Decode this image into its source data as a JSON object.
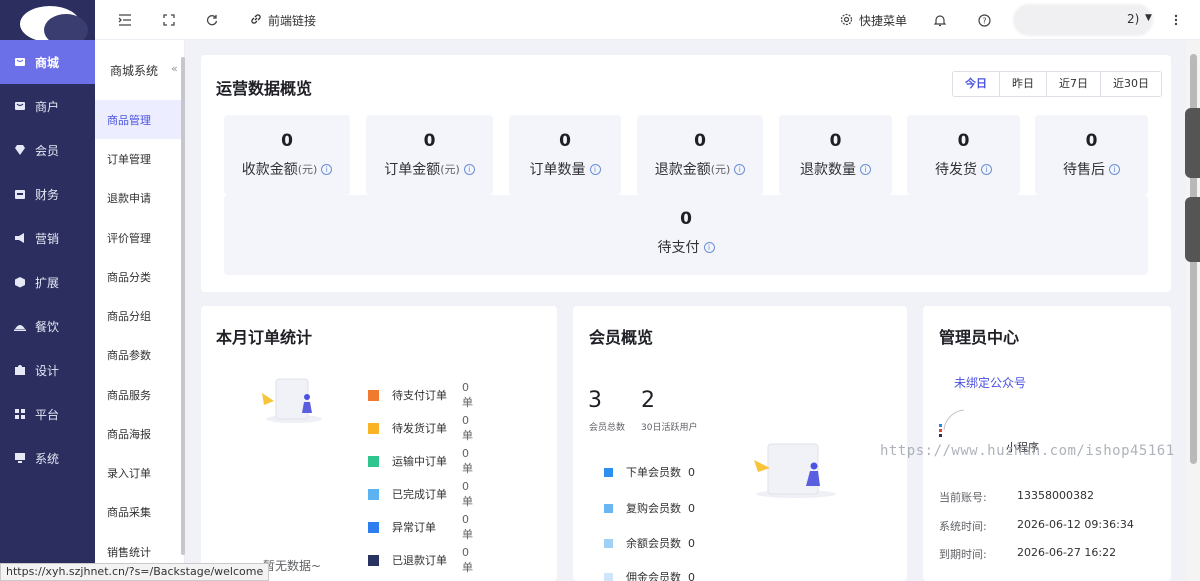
{
  "sidebar": {
    "items": [
      {
        "label": "商城",
        "icon": "shop-icon"
      },
      {
        "label": "商户",
        "icon": "merchant-icon"
      },
      {
        "label": "会员",
        "icon": "member-icon"
      },
      {
        "label": "财务",
        "icon": "finance-icon"
      },
      {
        "label": "营销",
        "icon": "megaphone-icon"
      },
      {
        "label": "扩展",
        "icon": "cube-icon"
      },
      {
        "label": "餐饮",
        "icon": "dining-icon"
      },
      {
        "label": "设计",
        "icon": "puzzle-icon"
      },
      {
        "label": "平台",
        "icon": "grid-icon"
      },
      {
        "label": "系统",
        "icon": "monitor-icon"
      }
    ]
  },
  "submenu": {
    "title": "商城系统",
    "collapse_glyph": "«",
    "items": [
      "商品管理",
      "订单管理",
      "退款申请",
      "评价管理",
      "商品分类",
      "商品分组",
      "商品参数",
      "商品服务",
      "商品海报",
      "录入订单",
      "商品采集",
      "销售统计"
    ]
  },
  "header": {
    "frontend_link": "前端链接",
    "quick_menu": "快捷菜单",
    "user_suffix": "2)"
  },
  "overview": {
    "title": "运营数据概览",
    "ranges": [
      "今日",
      "昨日",
      "近7日",
      "近30日"
    ],
    "stats": [
      {
        "value": "0",
        "label": "收款金额",
        "unit": "(元)"
      },
      {
        "value": "0",
        "label": "订单金额",
        "unit": "(元)"
      },
      {
        "value": "0",
        "label": "订单数量",
        "unit": ""
      },
      {
        "value": "0",
        "label": "退款金额",
        "unit": "(元)"
      },
      {
        "value": "0",
        "label": "退款数量",
        "unit": ""
      },
      {
        "value": "0",
        "label": "待发货",
        "unit": ""
      },
      {
        "value": "0",
        "label": "待售后",
        "unit": ""
      },
      {
        "value": "0",
        "label": "待支付",
        "unit": ""
      }
    ],
    "info_glyph": "i"
  },
  "orders": {
    "title": "本月订单统计",
    "empty_text": "暂无数据~",
    "legend": [
      {
        "label": "待支付订单",
        "count": "0单",
        "color": "#f07a30"
      },
      {
        "label": "待发货订单",
        "count": "0单",
        "color": "#f8b425"
      },
      {
        "label": "运输中订单",
        "count": "0单",
        "color": "#2ec58e"
      },
      {
        "label": "已完成订单",
        "count": "0单",
        "color": "#5db3f2"
      },
      {
        "label": "异常订单",
        "count": "0单",
        "color": "#2f7ef0"
      },
      {
        "label": "已退款订单",
        "count": "0单",
        "color": "#2a3360"
      }
    ]
  },
  "members": {
    "title": "会员概览",
    "total": "3",
    "total_label": "会员总数",
    "active": "2",
    "active_label": "30日活跃用户",
    "legend": [
      {
        "label": "下单会员数",
        "count": "0",
        "color": "#2f8ff0"
      },
      {
        "label": "复购会员数",
        "count": "0",
        "color": "#6ab6f2"
      },
      {
        "label": "余额会员数",
        "count": "0",
        "color": "#9fd1f6"
      },
      {
        "label": "佣金会员数",
        "count": "0",
        "color": "#cfe6fa"
      }
    ]
  },
  "admin": {
    "title": "管理员中心",
    "official_account": "未绑定公众号",
    "mini_program": "小程序",
    "rows": [
      {
        "label": "当前账号:",
        "value": "13358000382"
      },
      {
        "label": "系统时间:",
        "value": "2026-06-12 09:36:34"
      },
      {
        "label": "到期时间:",
        "value": "2026-06-27 16:22"
      }
    ]
  },
  "watermark": "https://www.huzhan.com/ishop45161",
  "status_url": "https://xyh.szjhnet.cn/?s=/Backstage/welcome",
  "colors": {
    "accent": "#6b6fe8",
    "sidebar_bg": "#2b2e5e"
  }
}
